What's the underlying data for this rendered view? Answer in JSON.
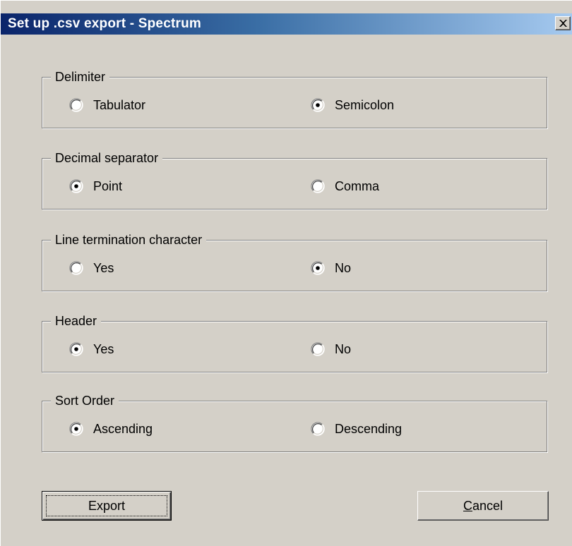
{
  "window": {
    "title": "Set up .csv export - Spectrum",
    "close_glyph": "close-icon"
  },
  "groups": [
    {
      "label": "Delimiter",
      "options": [
        "Tabulator",
        "Semicolon"
      ],
      "selected": 1
    },
    {
      "label": "Decimal separator",
      "options": [
        "Point",
        "Comma"
      ],
      "selected": 0
    },
    {
      "label": "Line termination character",
      "options": [
        "Yes",
        "No"
      ],
      "selected": 1
    },
    {
      "label": "Header",
      "options": [
        "Yes",
        "No"
      ],
      "selected": 0
    },
    {
      "label": "Sort Order",
      "options": [
        "Ascending",
        "Descending"
      ],
      "selected": 0
    }
  ],
  "buttons": {
    "export_label": "Export",
    "cancel_label": "Cancel",
    "cancel_accel": "C",
    "cancel_rest": "ancel"
  },
  "colors": {
    "face": "#d4d0c8",
    "title_start": "#0a246a",
    "title_end": "#a6caf0"
  }
}
